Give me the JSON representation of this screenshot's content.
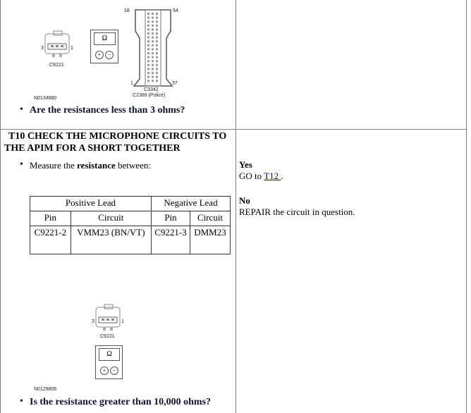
{
  "step_prev": {
    "figure": {
      "c9221_label": "C9221",
      "pin_left": "3",
      "pin_right": "1",
      "meter_symbol": "Ω",
      "meter_plus": "+",
      "meter_minus": "−",
      "c3342_label": "C3342",
      "c2389_label": "C2389 (Police)",
      "pin18": "18",
      "pin54": "54",
      "pin1": "1",
      "pin37": "37",
      "figure_id": "N0134680"
    },
    "question": "Are the resistances less than 3 ohms?"
  },
  "step": {
    "title": "T10 CHECK THE MICROPHONE CIRCUITS TO THE APIM FOR A SHORT TOGETHER",
    "instruction_prefix": "Measure the ",
    "instruction_bold": "resistance",
    "instruction_suffix": " between:",
    "table": {
      "group_headers": [
        "Positive Lead",
        "Negative Lead"
      ],
      "headers": [
        "Pin",
        "Circuit",
        "Pin",
        "Circuit"
      ],
      "rows": [
        [
          "C9221-2",
          "VMM23 (BN/VT)",
          "C9221-3",
          "DMM23"
        ]
      ]
    },
    "figure": {
      "c9221_label": "C9221",
      "pin_left": "3",
      "pin_right": "1",
      "meter_symbol": "Ω",
      "meter_plus": "+",
      "meter_minus": "−",
      "figure_id": "N0129806"
    },
    "question": "Is the resistance greater than 10,000 ohms?",
    "yes_label": "Yes",
    "yes_text": "GO to ",
    "yes_link": "T12 ",
    "yes_end": ".",
    "no_label": "No",
    "no_text": "REPAIR the circuit in question."
  }
}
